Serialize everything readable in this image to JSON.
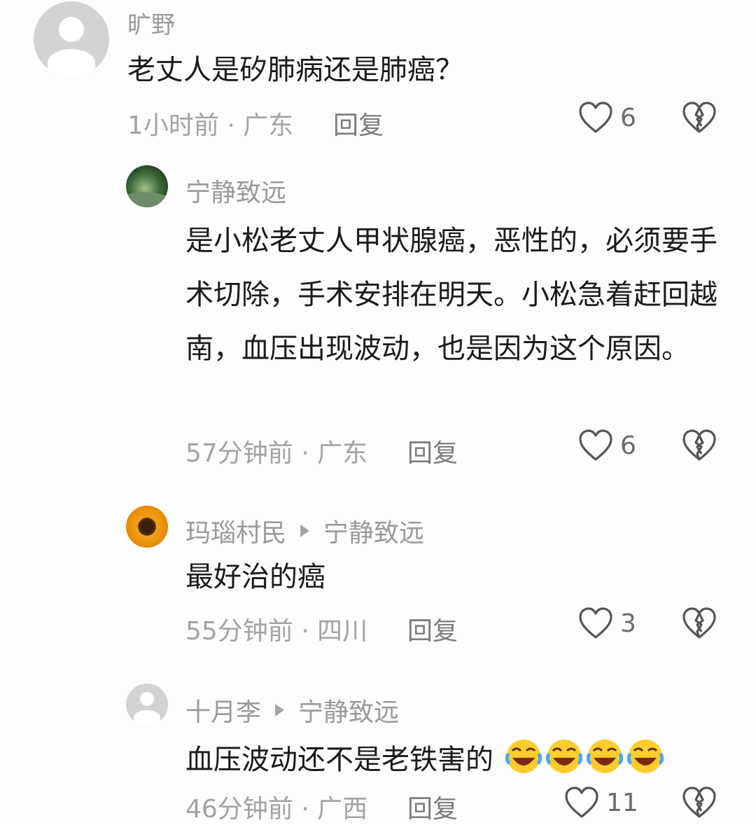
{
  "comments": [
    {
      "username": "旷野",
      "text": "老丈人是矽肺病还是肺癌？",
      "time": "1小时前",
      "location": "广东",
      "reply_label": "回复",
      "likes": "6"
    },
    {
      "username": "宁静致远",
      "text": "是小松老丈人甲状腺癌，恶性的，必须要手术切除，手术安排在明天。小松急着赶回越南，血压出现波动，也是因为这个原因。",
      "time": "57分钟前",
      "location": "广东",
      "reply_label": "回复",
      "likes": "6"
    },
    {
      "username": "玛瑙村民",
      "reply_to": "宁静致远",
      "text": "最好治的癌",
      "time": "55分钟前",
      "location": "四川",
      "reply_label": "回复",
      "likes": "3"
    },
    {
      "username": "十月李",
      "reply_to": "宁静致远",
      "text": "血压波动还不是老铁害的",
      "emoji": [
        "laughing-crying-emoji",
        "laughing-crying-emoji",
        "laughing-crying-emoji",
        "laughing-crying-emoji"
      ],
      "time": "46分钟前",
      "location": "广西",
      "reply_label": "回复",
      "likes": "11"
    }
  ],
  "separator": " · ",
  "colors": {
    "background": "#fdfdfd",
    "username": "#9a9a9a",
    "text": "#1b1b1b",
    "meta": "#a3a3a3",
    "icon": "#555555"
  }
}
